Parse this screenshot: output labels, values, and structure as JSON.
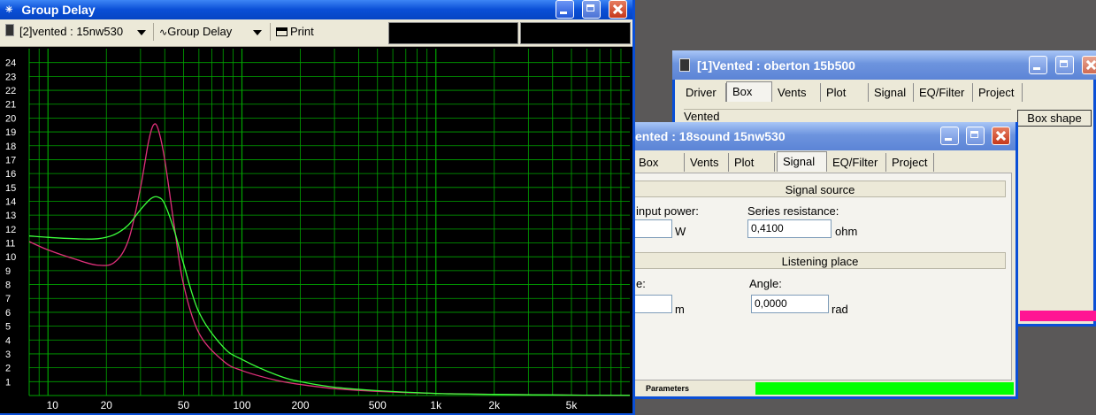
{
  "group_delay_window": {
    "title": "Group Delay",
    "toolbar": {
      "system_select": "[2]vented : 15nw530",
      "view_select": "Group Delay",
      "print_label": "Print"
    }
  },
  "oberton_window": {
    "title": "[1]Vented : oberton 15b500",
    "tabs": [
      "Driver",
      "Box",
      "Vents",
      "Plot",
      "Signal",
      "EQ/Filter",
      "Project"
    ],
    "active_tab": "Box",
    "box_type": "Vented",
    "box_shape_button": "Box shape"
  },
  "sound_window": {
    "title": "ented : 18sound 15nw530",
    "tabs": [
      "Box",
      "Vents",
      "Plot",
      "Signal",
      "EQ/Filter",
      "Project"
    ],
    "active_tab": "Signal",
    "signal_source": {
      "heading": "Signal source",
      "input_power_label": "input power:",
      "input_power_value": "",
      "input_power_unit": "W",
      "series_resistance_label": "Series resistance:",
      "series_resistance_value": "0,4100",
      "series_resistance_unit": "ohm"
    },
    "listening_place": {
      "heading": "Listening place",
      "distance_label": "e:",
      "distance_value": "",
      "distance_unit": "m",
      "angle_label": "Angle:",
      "angle_value": "0,0000",
      "angle_unit": "rad"
    },
    "status": {
      "label": "Parameters"
    }
  },
  "colors": {
    "plot_bg": "#000000",
    "grid": "#00a600",
    "series_1": "#e0307a",
    "series_2": "#3cff3c",
    "title_blue": "#0a4fd6",
    "status_green": "#00ff00",
    "status_pink": "#ff1493"
  },
  "chart_data": {
    "type": "line",
    "title": "",
    "xlabel": "",
    "ylabel": "",
    "x_scale": "log",
    "xlim": [
      8,
      10000
    ],
    "ylim": [
      0,
      25
    ],
    "x_ticks": [
      10,
      20,
      50,
      100,
      200,
      500,
      1000,
      2000,
      5000
    ],
    "x_tick_labels": [
      "10",
      "20",
      "50",
      "100",
      "200",
      "500",
      "1k",
      "2k",
      "5k"
    ],
    "y_ticks": [
      1,
      2,
      3,
      4,
      5,
      6,
      7,
      8,
      9,
      10,
      11,
      12,
      13,
      14,
      15,
      16,
      17,
      18,
      19,
      20,
      21,
      22,
      23,
      24
    ],
    "grid": true,
    "legend": "none",
    "series": [
      {
        "color": "#e0307a",
        "x": [
          8,
          10,
          14,
          18,
          22,
          26,
          30,
          33,
          35,
          37,
          40,
          45,
          50,
          60,
          80,
          100,
          150,
          200,
          300,
          500,
          1000,
          2000,
          5000,
          10000
        ],
        "y": [
          11.1,
          10.5,
          9.8,
          9.4,
          9.6,
          11.2,
          15.0,
          18.3,
          19.5,
          19.2,
          17.0,
          12.0,
          8.0,
          4.5,
          2.5,
          1.8,
          1.1,
          0.8,
          0.5,
          0.3,
          0.15,
          0.08,
          0.03,
          0.01
        ]
      },
      {
        "color": "#3cff3c",
        "x": [
          8,
          10,
          14,
          18,
          22,
          26,
          30,
          34,
          37,
          40,
          45,
          50,
          60,
          80,
          100,
          150,
          200,
          300,
          500,
          1000,
          2000,
          5000,
          10000
        ],
        "y": [
          11.5,
          11.4,
          11.3,
          11.3,
          11.6,
          12.3,
          13.4,
          14.2,
          14.3,
          13.8,
          11.8,
          9.5,
          6.0,
          3.5,
          2.6,
          1.5,
          1.0,
          0.6,
          0.35,
          0.15,
          0.08,
          0.03,
          0.01
        ]
      }
    ]
  }
}
